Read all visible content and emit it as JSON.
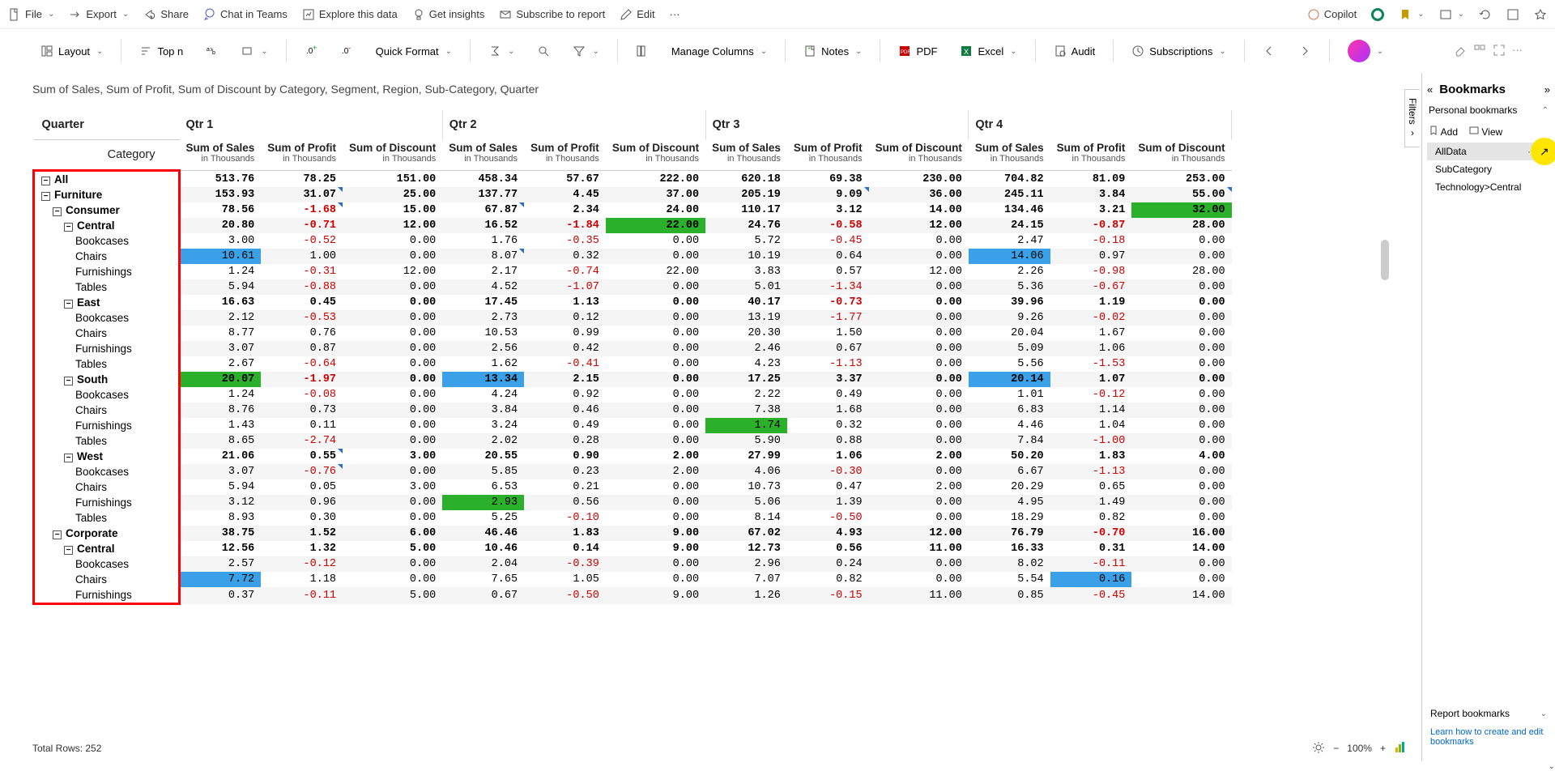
{
  "topbar": {
    "file": "File",
    "export": "Export",
    "share": "Share",
    "chat": "Chat in Teams",
    "explore": "Explore this data",
    "insights": "Get insights",
    "subscribe": "Subscribe to report",
    "edit": "Edit",
    "copilot": "Copilot"
  },
  "toolbar": {
    "layout": "Layout",
    "topn": "Top n",
    "quickformat": "Quick Format",
    "managecols": "Manage Columns",
    "notes": "Notes",
    "pdf": "PDF",
    "excel": "Excel",
    "audit": "Audit",
    "subscriptions": "Subscriptions"
  },
  "report": {
    "title": "Sum of Sales, Sum of Profit, Sum of Discount by Category, Segment, Region, Sub-Category, Quarter",
    "quarter_label": "Quarter",
    "category_label": "Category",
    "quarters": [
      "Qtr 1",
      "Qtr 2",
      "Qtr 3",
      "Qtr 4"
    ],
    "measures": [
      "Sum of Sales",
      "Sum of Profit",
      "Sum of Discount"
    ],
    "measure_sub": "in Thousands",
    "total_rows": "Total Rows: 252",
    "zoom": "100%"
  },
  "bookmarks": {
    "title": "Bookmarks",
    "personal": "Personal bookmarks",
    "add": "Add",
    "view": "View",
    "items": {
      "all": "AllData",
      "sub": "SubCategory",
      "tech": "Technology>Central"
    },
    "report_section": "Report bookmarks",
    "learn": "Learn how to create and edit bookmarks",
    "filters": "Filters"
  },
  "rows": [
    {
      "ind": 0,
      "t": 1,
      "s": 0,
      "lbl": "All",
      "v": [
        "513.76",
        "78.25",
        "151.00",
        "458.34",
        "57.67",
        "222.00",
        "620.18",
        "69.38",
        "230.00",
        "704.82",
        "81.09",
        "253.00"
      ]
    },
    {
      "ind": 0,
      "t": 1,
      "s": 1,
      "lbl": "Furniture",
      "v": [
        "153.93",
        "31.07",
        "25.00",
        "137.77",
        "4.45",
        "37.00",
        "205.19",
        "9.09",
        "36.00",
        "245.11",
        "3.84",
        "55.00"
      ],
      "cm": [
        1,
        7,
        11
      ]
    },
    {
      "ind": 1,
      "t": 1,
      "s": 0,
      "lbl": "Consumer",
      "v": [
        "78.56",
        "-1.68",
        "15.00",
        "67.87",
        "2.34",
        "24.00",
        "110.17",
        "3.12",
        "14.00",
        "134.46",
        "3.21",
        "32.00"
      ],
      "hl": {
        "11": "g"
      },
      "cm": [
        1,
        3
      ]
    },
    {
      "ind": 2,
      "t": 1,
      "s": 1,
      "lbl": "Central",
      "v": [
        "20.80",
        "-0.71",
        "12.00",
        "16.52",
        "-1.84",
        "22.00",
        "24.76",
        "-0.58",
        "12.00",
        "24.15",
        "-0.87",
        "28.00"
      ],
      "hl": {
        "5": "g"
      }
    },
    {
      "ind": 3,
      "t": 0,
      "s": 0,
      "lbl": "Bookcases",
      "v": [
        "3.00",
        "-0.52",
        "0.00",
        "1.76",
        "-0.35",
        "0.00",
        "5.72",
        "-0.45",
        "0.00",
        "2.47",
        "-0.18",
        "0.00"
      ]
    },
    {
      "ind": 3,
      "t": 0,
      "s": 1,
      "lbl": "Chairs",
      "v": [
        "10.61",
        "1.00",
        "0.00",
        "8.07",
        "0.32",
        "0.00",
        "10.19",
        "0.64",
        "0.00",
        "14.06",
        "0.97",
        "0.00"
      ],
      "hl": {
        "0": "b",
        "9": "b"
      },
      "cm": [
        3
      ]
    },
    {
      "ind": 3,
      "t": 0,
      "s": 0,
      "lbl": "Furnishings",
      "v": [
        "1.24",
        "-0.31",
        "12.00",
        "2.17",
        "-0.74",
        "22.00",
        "3.83",
        "0.57",
        "12.00",
        "2.26",
        "-0.98",
        "28.00"
      ]
    },
    {
      "ind": 3,
      "t": 0,
      "s": 1,
      "lbl": "Tables",
      "v": [
        "5.94",
        "-0.88",
        "0.00",
        "4.52",
        "-1.07",
        "0.00",
        "5.01",
        "-1.34",
        "0.00",
        "5.36",
        "-0.67",
        "0.00"
      ]
    },
    {
      "ind": 2,
      "t": 1,
      "s": 0,
      "lbl": "East",
      "v": [
        "16.63",
        "0.45",
        "0.00",
        "17.45",
        "1.13",
        "0.00",
        "40.17",
        "-0.73",
        "0.00",
        "39.96",
        "1.19",
        "0.00"
      ]
    },
    {
      "ind": 3,
      "t": 0,
      "s": 1,
      "lbl": "Bookcases",
      "v": [
        "2.12",
        "-0.53",
        "0.00",
        "2.73",
        "0.12",
        "0.00",
        "13.19",
        "-1.77",
        "0.00",
        "9.26",
        "-0.02",
        "0.00"
      ]
    },
    {
      "ind": 3,
      "t": 0,
      "s": 0,
      "lbl": "Chairs",
      "v": [
        "8.77",
        "0.76",
        "0.00",
        "10.53",
        "0.99",
        "0.00",
        "20.30",
        "1.50",
        "0.00",
        "20.04",
        "1.67",
        "0.00"
      ]
    },
    {
      "ind": 3,
      "t": 0,
      "s": 1,
      "lbl": "Furnishings",
      "v": [
        "3.07",
        "0.87",
        "0.00",
        "2.56",
        "0.42",
        "0.00",
        "2.46",
        "0.67",
        "0.00",
        "5.09",
        "1.06",
        "0.00"
      ]
    },
    {
      "ind": 3,
      "t": 0,
      "s": 0,
      "lbl": "Tables",
      "v": [
        "2.67",
        "-0.64",
        "0.00",
        "1.62",
        "-0.41",
        "0.00",
        "4.23",
        "-1.13",
        "0.00",
        "5.56",
        "-1.53",
        "0.00"
      ]
    },
    {
      "ind": 2,
      "t": 1,
      "s": 1,
      "lbl": "South",
      "v": [
        "20.07",
        "-1.97",
        "0.00",
        "13.34",
        "2.15",
        "0.00",
        "17.25",
        "3.37",
        "0.00",
        "20.14",
        "1.07",
        "0.00"
      ],
      "hl": {
        "0": "g",
        "3": "b",
        "9": "b"
      }
    },
    {
      "ind": 3,
      "t": 0,
      "s": 0,
      "lbl": "Bookcases",
      "v": [
        "1.24",
        "-0.08",
        "0.00",
        "4.24",
        "0.92",
        "0.00",
        "2.22",
        "0.49",
        "0.00",
        "1.01",
        "-0.12",
        "0.00"
      ]
    },
    {
      "ind": 3,
      "t": 0,
      "s": 1,
      "lbl": "Chairs",
      "v": [
        "8.76",
        "0.73",
        "0.00",
        "3.84",
        "0.46",
        "0.00",
        "7.38",
        "1.68",
        "0.00",
        "6.83",
        "1.14",
        "0.00"
      ]
    },
    {
      "ind": 3,
      "t": 0,
      "s": 0,
      "lbl": "Furnishings",
      "v": [
        "1.43",
        "0.11",
        "0.00",
        "3.24",
        "0.49",
        "0.00",
        "1.74",
        "0.32",
        "0.00",
        "4.46",
        "1.04",
        "0.00"
      ],
      "hl": {
        "6": "g"
      }
    },
    {
      "ind": 3,
      "t": 0,
      "s": 1,
      "lbl": "Tables",
      "v": [
        "8.65",
        "-2.74",
        "0.00",
        "2.02",
        "0.28",
        "0.00",
        "5.90",
        "0.88",
        "0.00",
        "7.84",
        "-1.00",
        "0.00"
      ]
    },
    {
      "ind": 2,
      "t": 1,
      "s": 0,
      "lbl": "West",
      "v": [
        "21.06",
        "0.55",
        "3.00",
        "20.55",
        "0.90",
        "2.00",
        "27.99",
        "1.06",
        "2.00",
        "50.20",
        "1.83",
        "4.00"
      ],
      "cm": [
        1
      ]
    },
    {
      "ind": 3,
      "t": 0,
      "s": 1,
      "lbl": "Bookcases",
      "v": [
        "3.07",
        "-0.76",
        "0.00",
        "5.85",
        "0.23",
        "2.00",
        "4.06",
        "-0.30",
        "0.00",
        "6.67",
        "-1.13",
        "0.00"
      ],
      "cm": [
        1
      ]
    },
    {
      "ind": 3,
      "t": 0,
      "s": 0,
      "lbl": "Chairs",
      "v": [
        "5.94",
        "0.05",
        "3.00",
        "6.53",
        "0.21",
        "0.00",
        "10.73",
        "0.47",
        "2.00",
        "20.29",
        "0.65",
        "0.00"
      ]
    },
    {
      "ind": 3,
      "t": 0,
      "s": 1,
      "lbl": "Furnishings",
      "v": [
        "3.12",
        "0.96",
        "0.00",
        "2.93",
        "0.56",
        "0.00",
        "5.06",
        "1.39",
        "0.00",
        "4.95",
        "1.49",
        "0.00"
      ],
      "hl": {
        "3": "g"
      }
    },
    {
      "ind": 3,
      "t": 0,
      "s": 0,
      "lbl": "Tables",
      "v": [
        "8.93",
        "0.30",
        "0.00",
        "5.25",
        "-0.10",
        "0.00",
        "8.14",
        "-0.50",
        "0.00",
        "18.29",
        "0.82",
        "0.00"
      ]
    },
    {
      "ind": 1,
      "t": 1,
      "s": 1,
      "lbl": "Corporate",
      "v": [
        "38.75",
        "1.52",
        "6.00",
        "46.46",
        "1.83",
        "9.00",
        "67.02",
        "4.93",
        "12.00",
        "76.79",
        "-0.70",
        "16.00"
      ]
    },
    {
      "ind": 2,
      "t": 1,
      "s": 0,
      "lbl": "Central",
      "v": [
        "12.56",
        "1.32",
        "5.00",
        "10.46",
        "0.14",
        "9.00",
        "12.73",
        "0.56",
        "11.00",
        "16.33",
        "0.31",
        "14.00"
      ]
    },
    {
      "ind": 3,
      "t": 0,
      "s": 1,
      "lbl": "Bookcases",
      "v": [
        "2.57",
        "-0.12",
        "0.00",
        "2.04",
        "-0.39",
        "0.00",
        "2.96",
        "0.24",
        "0.00",
        "8.02",
        "-0.11",
        "0.00"
      ]
    },
    {
      "ind": 3,
      "t": 0,
      "s": 0,
      "lbl": "Chairs",
      "v": [
        "7.72",
        "1.18",
        "0.00",
        "7.65",
        "1.05",
        "0.00",
        "7.07",
        "0.82",
        "0.00",
        "5.54",
        "0.16",
        "0.00"
      ],
      "hl": {
        "0": "b",
        "10": "b"
      }
    },
    {
      "ind": 3,
      "t": 0,
      "s": 1,
      "lbl": "Furnishings",
      "v": [
        "0.37",
        "-0.11",
        "5.00",
        "0.67",
        "-0.50",
        "9.00",
        "1.26",
        "-0.15",
        "11.00",
        "0.85",
        "-0.45",
        "14.00"
      ]
    }
  ]
}
